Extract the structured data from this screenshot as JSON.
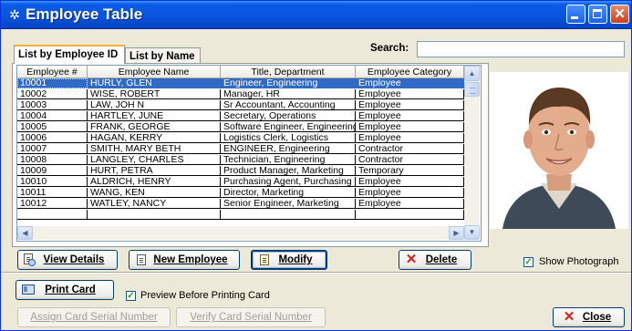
{
  "window": {
    "title": "Employee Table"
  },
  "tabs": [
    {
      "label": "List by Employee ID",
      "active": true
    },
    {
      "label": "List by Name",
      "active": false
    }
  ],
  "search": {
    "label": "Search:",
    "value": ""
  },
  "grid": {
    "columns": [
      "Employee #",
      "Employee Name",
      "Title, Department",
      "Employee Category"
    ],
    "rows": [
      [
        "10001",
        "HURLY, GLEN",
        "Engineer, Engineering",
        "Employee"
      ],
      [
        "10002",
        "WISE, ROBERT",
        "Manager, HR",
        "Employee"
      ],
      [
        "10003",
        "LAW, JOH N",
        "Sr Accountant, Accounting",
        "Employee"
      ],
      [
        "10004",
        "HARTLEY, JUNE",
        "Secretary, Operations",
        "Employee"
      ],
      [
        "10005",
        "FRANK, GEORGE",
        "Software Engineer, Engineering",
        "Employee"
      ],
      [
        "10006",
        "HAGAN, KERRY",
        "Logistics Clerk, Logistics",
        "Employee"
      ],
      [
        "10007",
        "SMITH, MARY BETH",
        "ENGINEER, Engineering",
        "Contractor"
      ],
      [
        "10008",
        "LANGLEY, CHARLES",
        "Technician, Engineering",
        "Contractor"
      ],
      [
        "10009",
        "HURT, PETRA",
        "Product Manager, Marketing",
        "Temporary"
      ],
      [
        "10010",
        "ALDRICH, HENRY",
        "Purchasing Agent, Purchasing",
        "Employee"
      ],
      [
        "10011",
        "WANG, KEN",
        "Director, Marketing",
        "Employee"
      ],
      [
        "10012",
        "WATLEY, NANCY",
        "Senior Engineer, Marketing",
        "Employee"
      ],
      [
        "",
        "",
        "",
        ""
      ]
    ],
    "selected_row": 0
  },
  "buttons": {
    "view_details": "View Details",
    "new_employee": "New Employee",
    "modify": "Modify",
    "delete": "Delete",
    "print_card": "Print Card",
    "assign_serial": "Assign Card Serial Number",
    "verify_serial": "Verify Card Serial Number",
    "close": "Close"
  },
  "options": {
    "show_photograph": {
      "label": "Show Photograph",
      "checked": true
    },
    "preview_before_printing": {
      "label": "Preview Before Printing Card",
      "checked": true
    }
  },
  "icons": {
    "title": "app-icon",
    "view_details": "magnifier-document-icon",
    "new_employee": "new-document-icon",
    "modify": "edit-document-icon",
    "delete": "red-x-icon",
    "print_card": "id-card-icon",
    "close": "red-x-icon"
  },
  "colors": {
    "titlebar": "#0A53DD",
    "selection": "#316AC5",
    "window_bg": "#ECE9D8",
    "delete_red": "#D4201A"
  }
}
